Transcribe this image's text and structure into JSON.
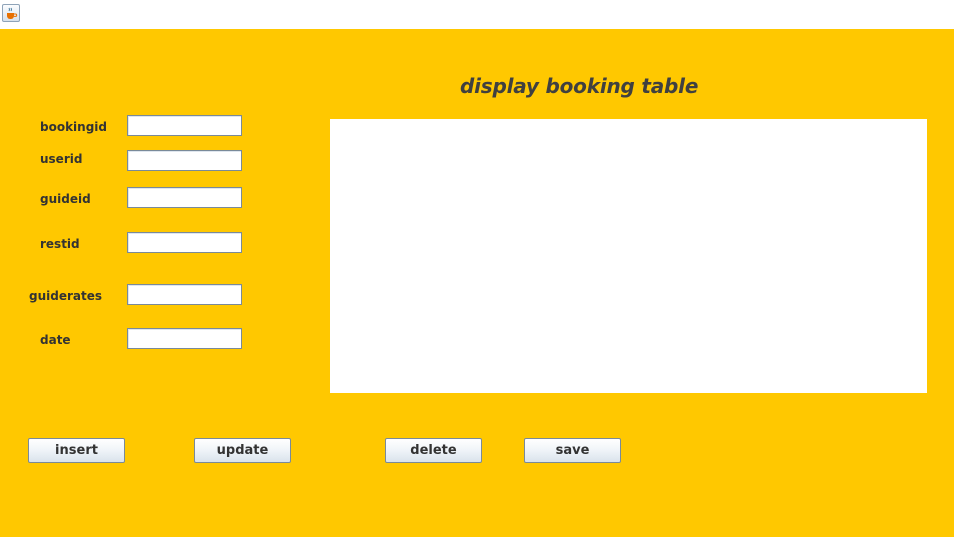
{
  "window": {
    "icon": "java-cup-icon"
  },
  "heading": "display booking table",
  "form": {
    "fields": [
      {
        "label": "bookingid",
        "value": ""
      },
      {
        "label": "userid",
        "value": ""
      },
      {
        "label": "guideid",
        "value": ""
      },
      {
        "label": "restid",
        "value": ""
      },
      {
        "label": "guiderates",
        "value": ""
      },
      {
        "label": "date",
        "value": ""
      }
    ]
  },
  "buttons": {
    "insert": "insert",
    "update": "update",
    "delete": "delete",
    "save": "save"
  },
  "colors": {
    "panel_background": "#ffc800",
    "heading_text": "#404040",
    "table_background": "#ffffff"
  }
}
